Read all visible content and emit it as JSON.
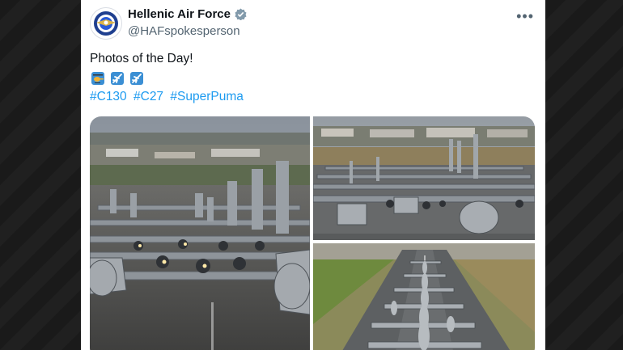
{
  "post": {
    "author_name": "Hellenic Air Force",
    "author_handle": "@HAFspokesperson",
    "text": "Photos of the Day!",
    "emojis": [
      "helicopter-emoji",
      "airplane-emoji",
      "airplane-emoji"
    ],
    "hashtags": [
      "#C130",
      "#C27",
      "#SuperPuma"
    ]
  },
  "media": {
    "photos": [
      {
        "subject": "aircraft-lineup-runway"
      },
      {
        "subject": "aircraft-lineup-apron"
      },
      {
        "subject": "aircraft-lineup-aerial"
      }
    ]
  },
  "colors": {
    "link": "#1d9bf0",
    "verified": "#829aab",
    "text": "#0f1419",
    "secondary": "#536471"
  }
}
